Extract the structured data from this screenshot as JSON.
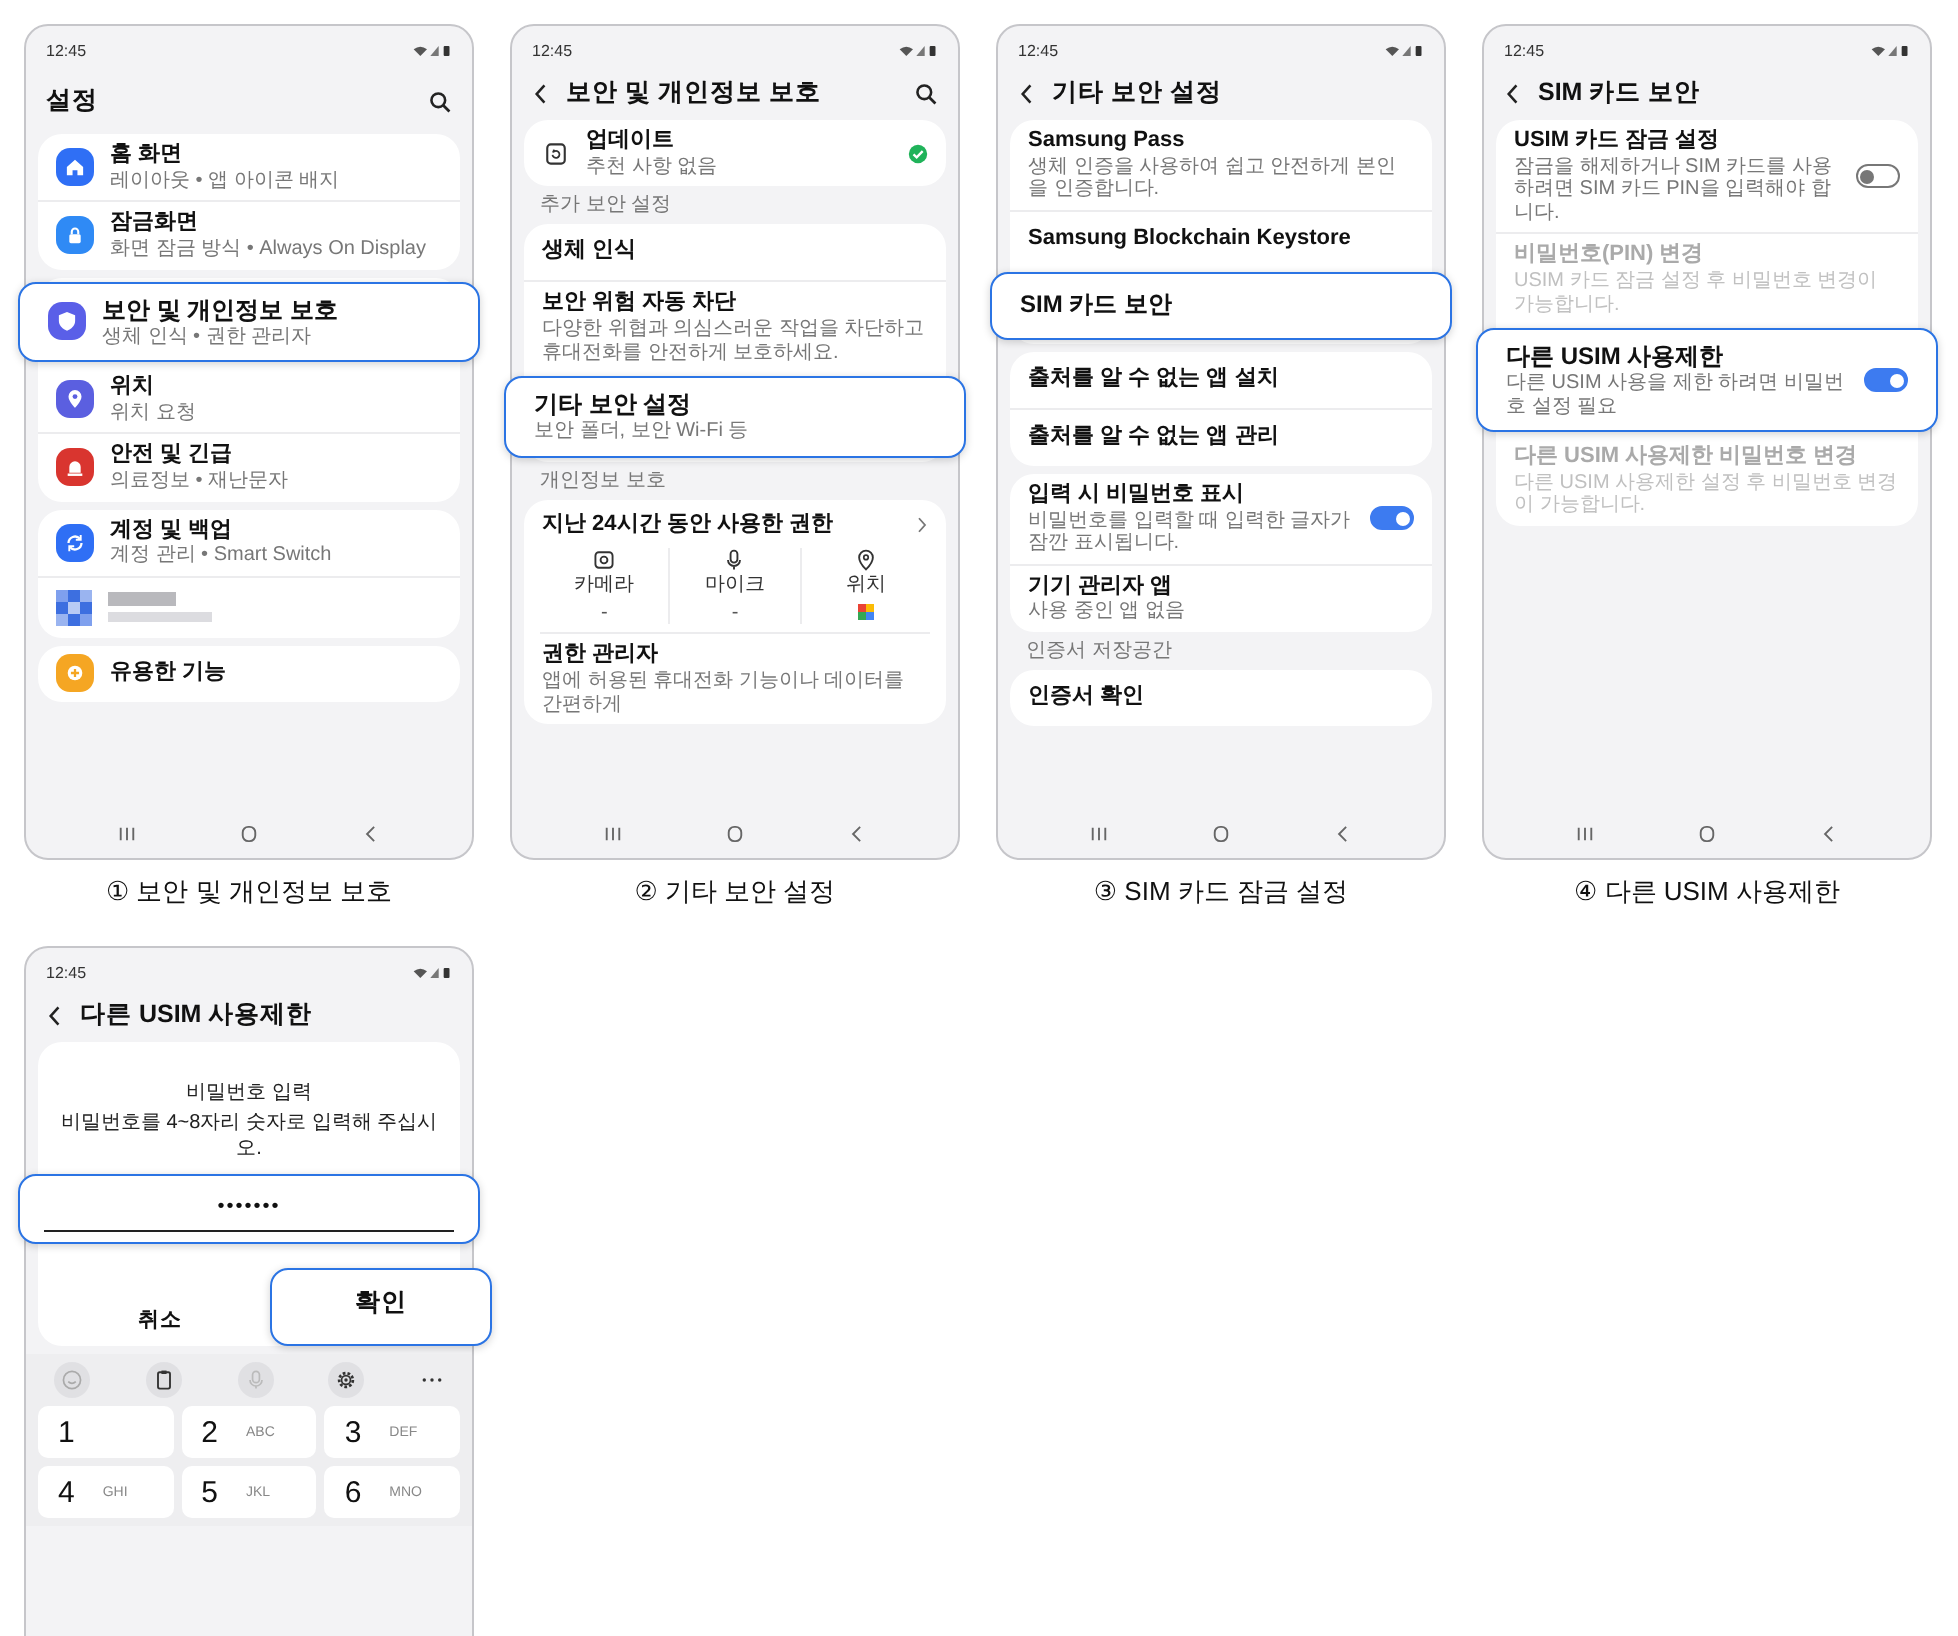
{
  "steps": [
    {
      "caption": "① 보안 및 개인정보 보호",
      "screen": {
        "kind": "settings",
        "time": "12:45",
        "title": "설정",
        "back": false,
        "search": true,
        "groups": [
          {
            "items": [
              {
                "kind": "row",
                "title": "홈 화면",
                "subtitle": "레이아웃 • 앱 아이콘 배지",
                "color": "#2f6ff5",
                "highlighted": false,
                "disabled": false
              },
              {
                "kind": "row",
                "title": "잠금화면",
                "subtitle": "화면 잠금 방식 • Always On Display",
                "color": "#2f8af5",
                "highlighted": false,
                "disabled": false
              }
            ]
          },
          {
            "items": [
              {
                "kind": "row",
                "title": "보안 및 개인정보 보호",
                "subtitle": "생체 인식 • 권한 관리자",
                "color": "#5a5fe8",
                "highlighted": true,
                "disabled": false
              },
              {
                "kind": "row",
                "title": "위치",
                "subtitle": "위치 요청",
                "color": "#5b5fe0",
                "highlighted": false,
                "disabled": false
              },
              {
                "kind": "row",
                "title": "안전 및 긴급",
                "subtitle": "의료정보 • 재난문자",
                "color": "#d9352f",
                "highlighted": false,
                "disabled": false
              }
            ]
          },
          {
            "items": [
              {
                "kind": "row",
                "title": "계정 및 백업",
                "subtitle": "계정 관리 • Smart Switch",
                "color": "#2f6ff5",
                "highlighted": false,
                "disabled": false
              },
              {
                "kind": "blurred"
              }
            ]
          },
          {
            "items": [
              {
                "kind": "row",
                "title": "유용한 기능",
                "color": "#f5a623",
                "highlighted": false,
                "disabled": false
              }
            ]
          }
        ]
      }
    },
    {
      "caption": "② 기타 보안 설정",
      "screen": {
        "kind": "settings",
        "time": "12:45",
        "title": "보안 및 개인정보 보호",
        "back": true,
        "search": true,
        "groups": [
          {
            "items": [
              {
                "kind": "status",
                "title": "업데이트",
                "subtitle": "추천 사항 없음",
                "ok": true
              }
            ]
          },
          {
            "label": "추가 보안 설정",
            "items": [
              {
                "kind": "row",
                "title": "생체 인식",
                "highlighted": false,
                "disabled": false
              },
              {
                "kind": "row",
                "title": "보안 위험 자동 차단",
                "subtitle": "다양한 위협과 의심스러운 작업을 차단하고 휴대전화를 안전하게 보호하세요.",
                "highlighted": false,
                "disabled": false
              },
              {
                "kind": "row",
                "title": "기타 보안 설정",
                "subtitle": "보안 폴더, 보안 Wi-Fi 등",
                "highlighted": true,
                "disabled": false
              }
            ]
          },
          {
            "label": "개인정보 보호",
            "items": [
              {
                "kind": "usage",
                "title": "지난 24시간 동안 사용한 권한",
                "columns": [
                  {
                    "label": "카메라",
                    "kind": "text",
                    "value": "-"
                  },
                  {
                    "label": "마이크",
                    "kind": "text",
                    "value": "-"
                  },
                  {
                    "label": "위치",
                    "kind": "app"
                  }
                ]
              },
              {
                "kind": "row",
                "title": "권한 관리자",
                "subtitle": "앱에 허용된 휴대전화 기능이나 데이터를 간편하게",
                "highlighted": false,
                "disabled": false
              }
            ]
          }
        ]
      }
    },
    {
      "caption": "③ SIM 카드 잠금 설정",
      "screen": {
        "kind": "settings",
        "time": "12:45",
        "title": "기타 보안 설정",
        "back": true,
        "search": false,
        "groups": [
          {
            "items": [
              {
                "kind": "row",
                "title": "Samsung Pass",
                "subtitle": "생체 인증을 사용하여 쉽고 안전하게 본인을 인증합니다.",
                "highlighted": false,
                "disabled": false
              },
              {
                "kind": "row",
                "title": "Samsung Blockchain Keystore",
                "highlighted": false,
                "disabled": false
              },
              {
                "kind": "row",
                "title": "SIM 카드 보안",
                "highlighted": true,
                "disabled": false
              }
            ]
          },
          {
            "items": [
              {
                "kind": "row",
                "title": "출처를 알 수 없는 앱 설치",
                "highlighted": false,
                "disabled": false
              },
              {
                "kind": "row",
                "title": "출처를 알 수 없는 앱 관리",
                "highlighted": false,
                "disabled": false
              }
            ]
          },
          {
            "items": [
              {
                "kind": "row",
                "title": "입력 시 비밀번호 표시",
                "subtitle": "비밀번호를 입력할 때 입력한 글자가 잠깐 표시됩니다.",
                "toggle": {
                  "on": true
                },
                "highlighted": false,
                "disabled": false
              },
              {
                "kind": "row",
                "title": "기기 관리자 앱",
                "subtitle": "사용 중인 앱 없음",
                "highlighted": false,
                "disabled": false
              }
            ]
          },
          {
            "label": "인증서 저장공간",
            "items": [
              {
                "kind": "row",
                "title": "인증서 확인",
                "highlighted": false,
                "disabled": false
              }
            ]
          }
        ]
      }
    },
    {
      "caption": "④ 다른 USIM 사용제한",
      "screen": {
        "kind": "settings",
        "time": "12:45",
        "title": "SIM 카드 보안",
        "back": true,
        "search": false,
        "groups": [
          {
            "items": [
              {
                "kind": "row",
                "title": "USIM 카드 잠금 설정",
                "subtitle": "잠금을 해제하거나 SIM 카드를 사용하려면 SIM 카드 PIN을 입력해야 합니다.",
                "toggle": {
                  "on": false
                },
                "highlighted": false,
                "disabled": false
              },
              {
                "kind": "row",
                "title": "비밀번호(PIN) 변경",
                "subtitle": "USIM 카드 잠금 설정 후 비밀번호 변경이 가능합니다.",
                "highlighted": false,
                "disabled": true
              },
              {
                "kind": "row",
                "title": "다른 USIM 사용제한",
                "subtitle": "다른 USIM 사용을 제한 하려면 비밀번호 설정 필요",
                "toggle": {
                  "on": true
                },
                "highlighted": true,
                "disabled": false
              },
              {
                "kind": "row",
                "title": "다른 USIM 사용제한 비밀번호 변경",
                "subtitle": "다른 USIM 사용제한 설정 후 비밀번호 변경이 가능합니다.",
                "highlighted": false,
                "disabled": true
              }
            ]
          }
        ]
      }
    },
    {
      "screen": {
        "kind": "password",
        "time": "12:45",
        "title": "다른 USIM 사용제한",
        "back": true,
        "prompt": "비밀번호 입력",
        "hint": "비밀번호를 4~8자리 숫자로 입력해 주십시오.",
        "field": {
          "value": "•••••••",
          "highlighted": true
        },
        "buttons": [
          {
            "label": "취소",
            "highlighted": false
          },
          {
            "label": "확인",
            "highlighted": true
          }
        ],
        "keys": [
          {
            "digit": "1"
          },
          {
            "digit": "2",
            "letters": "ABC"
          },
          {
            "digit": "3",
            "letters": "DEF"
          },
          {
            "digit": "4",
            "letters": "GHI"
          },
          {
            "digit": "5",
            "letters": "JKL"
          },
          {
            "digit": "6",
            "letters": "MNO"
          }
        ]
      }
    }
  ]
}
